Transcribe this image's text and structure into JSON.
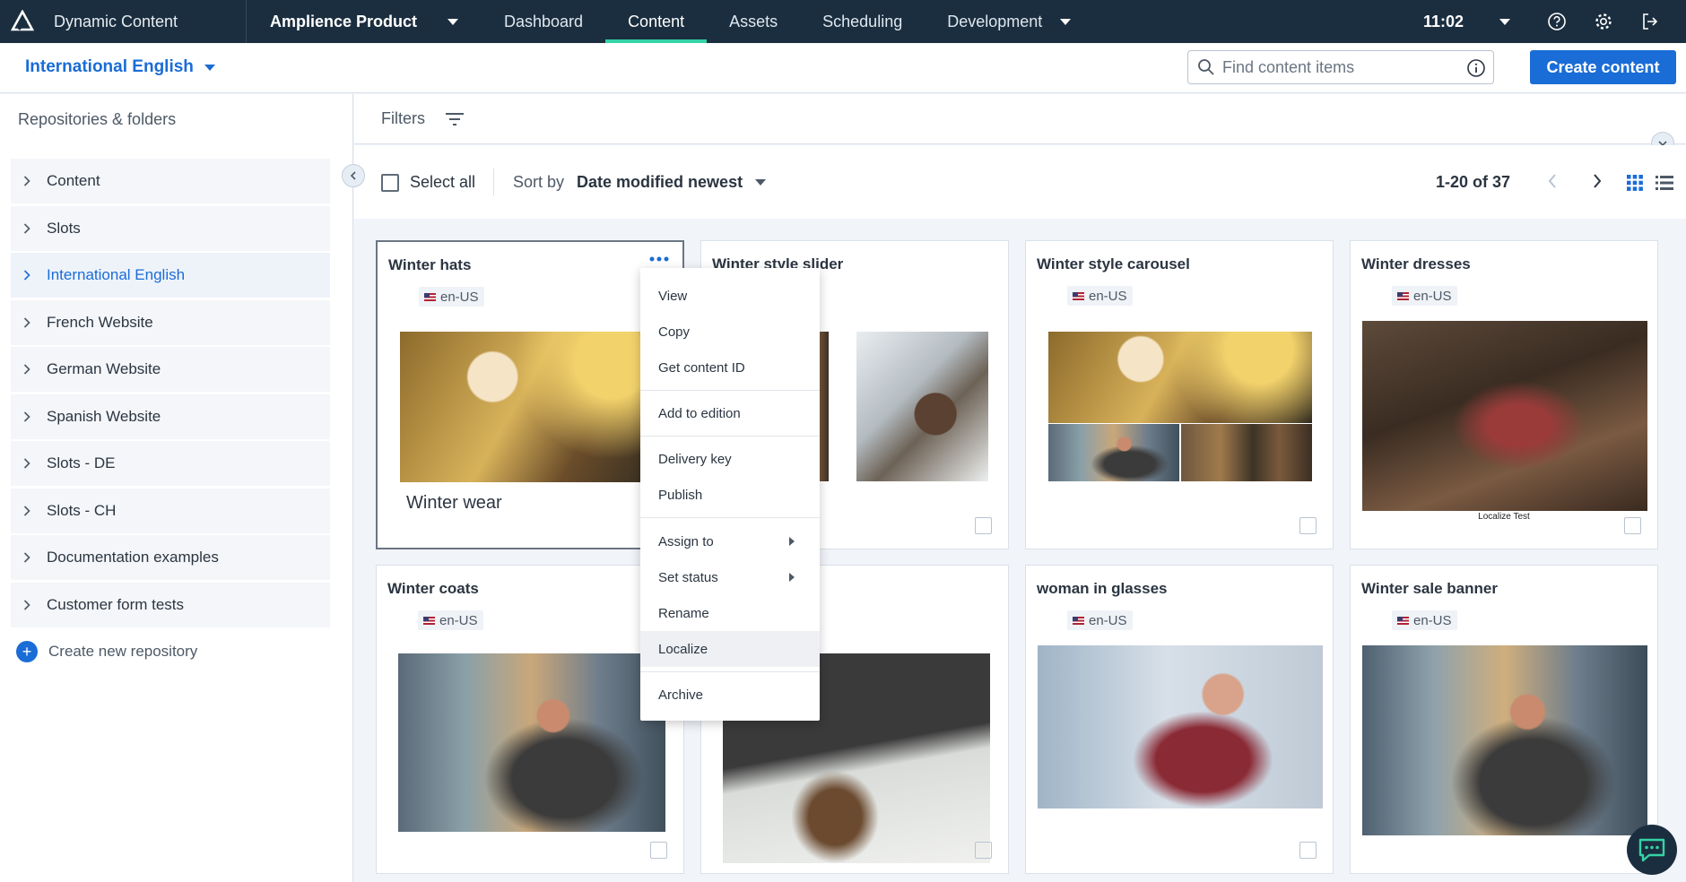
{
  "app": {
    "name": "Dynamic Content",
    "product": "Amplience Product",
    "time": "11:02"
  },
  "nav": {
    "tabs": [
      "Dashboard",
      "Content",
      "Assets",
      "Scheduling",
      "Development"
    ],
    "active": "Content"
  },
  "locale": {
    "selected": "International English"
  },
  "search": {
    "placeholder": "Find content items"
  },
  "create_button": "Create content",
  "sidebar": {
    "title": "Repositories & folders",
    "items": [
      "Content",
      "Slots",
      "International English",
      "French Website",
      "German Website",
      "Spanish Website",
      "Slots - DE",
      "Slots - CH",
      "Documentation examples",
      "Customer form tests"
    ],
    "active": "International English",
    "create_new": "Create new repository"
  },
  "filters": {
    "label": "Filters"
  },
  "toolbar": {
    "select_all": "Select all",
    "sort_label": "Sort by",
    "sort_value": "Date modified newest",
    "pagination": "1-20 of 37"
  },
  "cards": [
    {
      "title": "Winter hats",
      "locale": "en-US",
      "caption": "Winter wear"
    },
    {
      "title": "Winter style slider"
    },
    {
      "title": "Winter style carousel",
      "locale": "en-US"
    },
    {
      "title": "Winter dresses",
      "locale": "en-US",
      "caption": "Localize Test"
    },
    {
      "title": "Winter coats",
      "locale": "en-US"
    },
    {
      "title": ""
    },
    {
      "title": "woman in glasses",
      "locale": "en-US"
    },
    {
      "title": "Winter sale banner",
      "locale": "en-US"
    }
  ],
  "context_menu": {
    "items": [
      "View",
      "Copy",
      "Get content ID",
      "Add to edition",
      "Delivery key",
      "Publish",
      "Assign to",
      "Set status",
      "Rename",
      "Localize",
      "Archive"
    ],
    "hovered": "Localize"
  },
  "colors": {
    "nav_bg": "#1b2e3f",
    "accent": "#1a6cd6",
    "active_tab": "#34d3a5"
  }
}
